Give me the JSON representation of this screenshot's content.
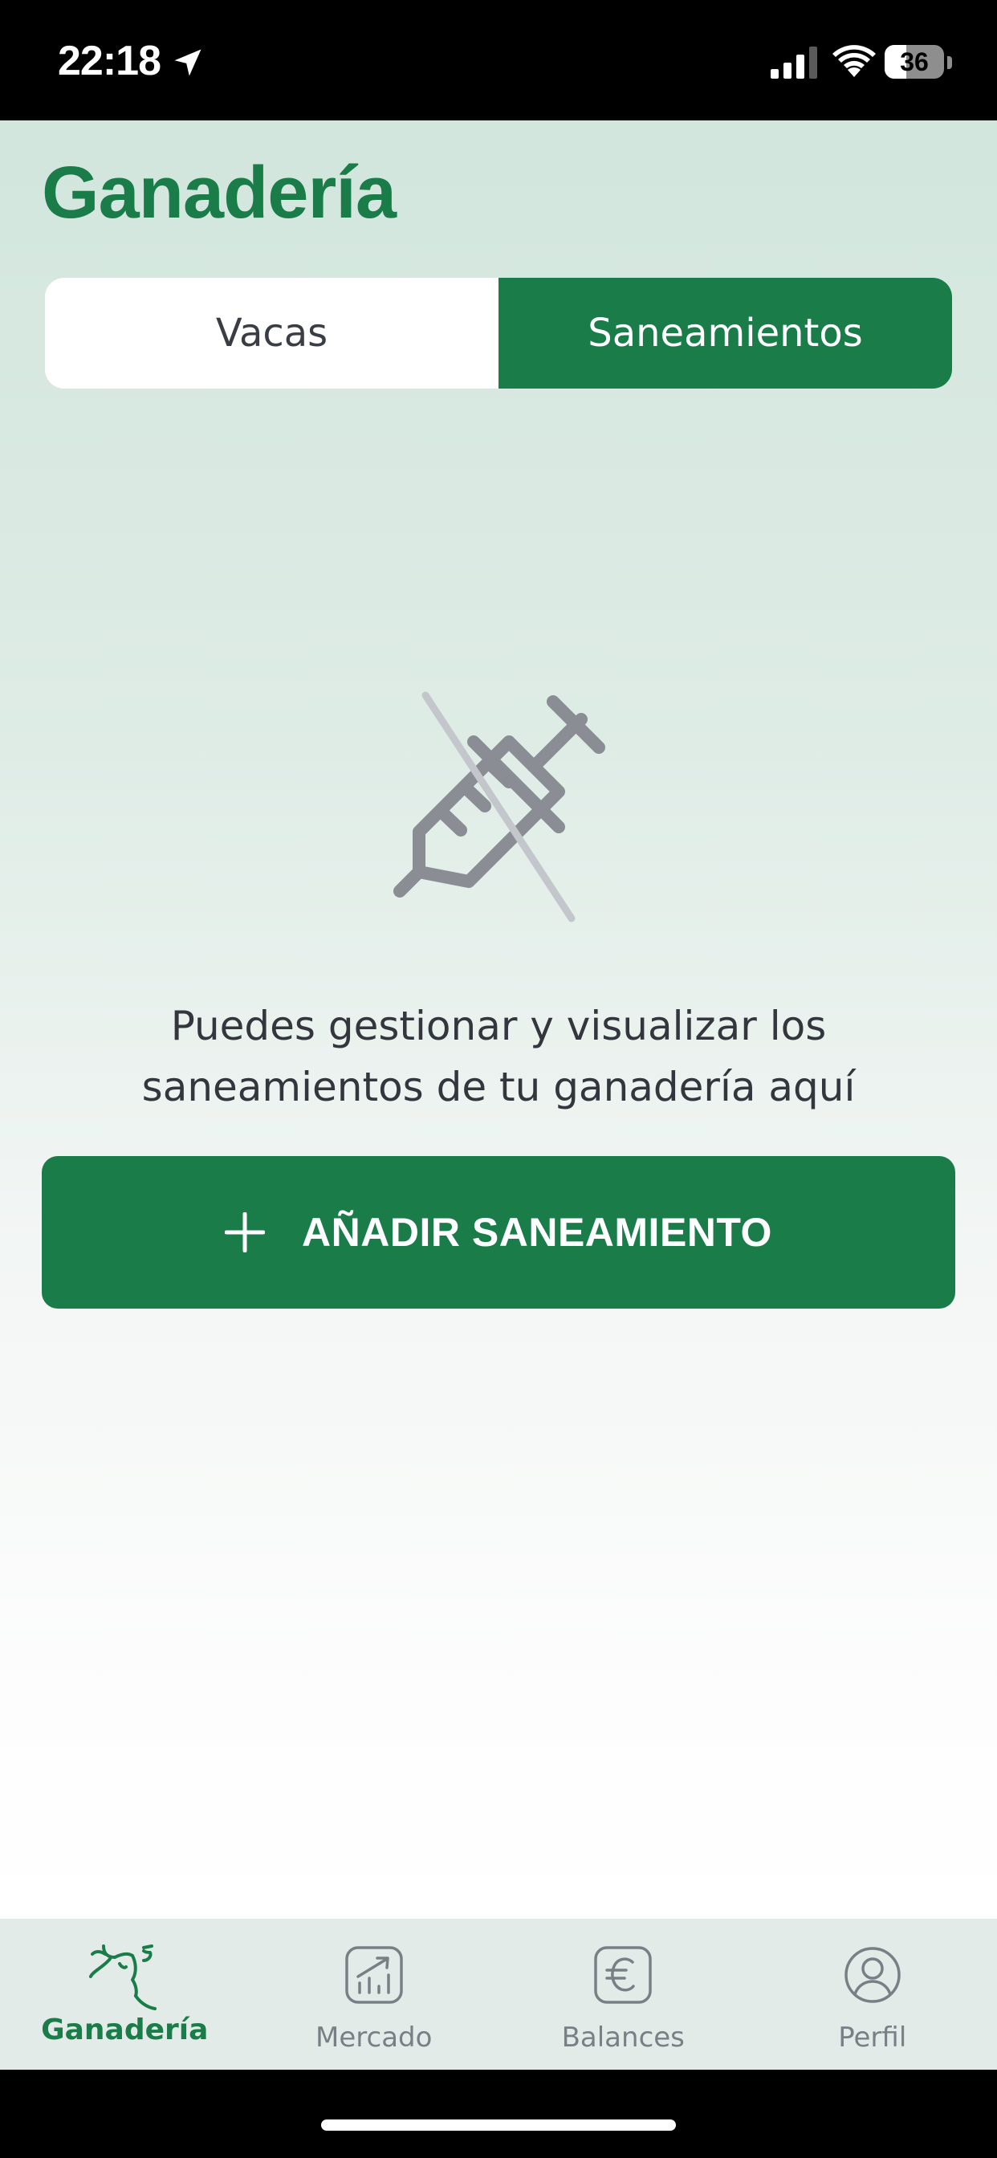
{
  "status_bar": {
    "time": "22:18",
    "battery": "36",
    "battery_level": 0.36
  },
  "header": {
    "title": "Ganadería"
  },
  "segments": {
    "cows": "Vacas",
    "sanitation": "Saneamientos",
    "selected": "Saneamientos"
  },
  "empty_state": {
    "icon": "syringe-off-icon",
    "message": "Puedes gestionar y visualizar los saneamientos de tu ganadería aquí"
  },
  "actions": {
    "add_label": "AÑADIR SANEAMIENTO"
  },
  "tabbar": {
    "items": [
      {
        "label": "Ganadería",
        "icon": "cow-icon",
        "active": true
      },
      {
        "label": "Mercado",
        "icon": "chart-up-icon",
        "active": false
      },
      {
        "label": "Balances",
        "icon": "euro-icon",
        "active": false
      },
      {
        "label": "Perfil",
        "icon": "profile-icon",
        "active": false
      }
    ]
  },
  "colors": {
    "brand_green": "#1a7d49",
    "icon_gray": "#8a8d93"
  }
}
